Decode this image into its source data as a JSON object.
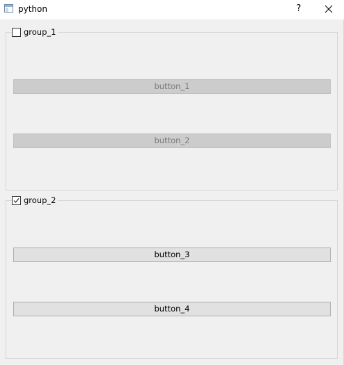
{
  "window": {
    "title": "python",
    "help_label": "?",
    "icon": "python-window-icon"
  },
  "groups": [
    {
      "title": "group_1",
      "checked": false,
      "buttons": [
        {
          "label": "button_1",
          "enabled": false
        },
        {
          "label": "button_2",
          "enabled": false
        }
      ]
    },
    {
      "title": "group_2",
      "checked": true,
      "buttons": [
        {
          "label": "button_3",
          "enabled": true
        },
        {
          "label": "button_4",
          "enabled": true
        }
      ]
    }
  ],
  "colors": {
    "window_bg": "#f0f0f0",
    "titlebar_bg": "#ffffff",
    "disabled_button_bg": "#cccccc",
    "disabled_button_text": "#7a7a7a",
    "enabled_button_bg": "#e1e1e1",
    "group_border": "#d5d5d5"
  }
}
